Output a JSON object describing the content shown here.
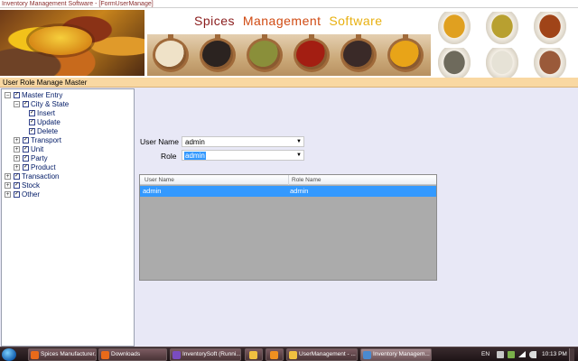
{
  "window": {
    "title": "Inventory Management Software - [FormUserManage]"
  },
  "banner": {
    "title_parts": [
      "Spices",
      "Management",
      "Software"
    ],
    "colors": {
      "spices": "#8a1c1c",
      "management": "#d04a12",
      "software": "#e8b010"
    },
    "spoon_colors": [
      "#efe2c8",
      "#2b2320",
      "#8a8f3a",
      "#a31e12",
      "#3a2a28",
      "#e8a418"
    ],
    "powder_colors": [
      "#e0a020",
      "#b8a030",
      "#a04418",
      "#6e6a5c",
      "#e6e2d6",
      "#9a5a3a"
    ]
  },
  "master": {
    "header": "User Role Manage Master"
  },
  "tree": {
    "nodes": [
      {
        "label": "Master Entry",
        "expander": "⊟",
        "checked": true
      },
      {
        "label": "City & State",
        "expander": "⊟",
        "checked": true
      },
      {
        "label": "Insert",
        "expander": "",
        "checked": true
      },
      {
        "label": "Update",
        "expander": "",
        "checked": true
      },
      {
        "label": "Delete",
        "expander": "",
        "checked": true
      },
      {
        "label": "Transport",
        "expander": "⊞",
        "checked": true
      },
      {
        "label": "Unit",
        "expander": "⊞",
        "checked": true
      },
      {
        "label": "Party",
        "expander": "⊞",
        "checked": true
      },
      {
        "label": "Product",
        "expander": "⊞",
        "checked": true
      },
      {
        "label": "Transaction",
        "expander": "⊞",
        "checked": true
      },
      {
        "label": "Stock",
        "expander": "⊞",
        "checked": true
      },
      {
        "label": "Other",
        "expander": "⊞",
        "checked": true
      }
    ]
  },
  "form": {
    "user_name_label": "User Name",
    "user_name_value": "admin",
    "role_label": "Role",
    "role_value": "admin",
    "dropdown_arrow": "▼"
  },
  "grid": {
    "columns": [
      "User Name",
      "Role Name"
    ],
    "rows": [
      [
        "admin",
        "admin"
      ]
    ],
    "selection_color": "#3399ff"
  },
  "taskbar": {
    "items": [
      {
        "label": "Spices Manufacturer...",
        "icon": "firefox-icon",
        "color": "#e86a1a"
      },
      {
        "label": "Downloads",
        "icon": "firefox-icon",
        "color": "#e86a1a"
      },
      {
        "label": "InventorySoft (Runni...",
        "icon": "visual-studio-icon",
        "color": "#7a4cc0"
      },
      {
        "label": "",
        "icon": "folder-icon",
        "color": "#f0c040"
      },
      {
        "label": "",
        "icon": "media-player-icon",
        "color": "#f09020"
      },
      {
        "label": "UserManagement - ...",
        "icon": "folder-icon",
        "color": "#f0c040"
      },
      {
        "label": "Inventory Managem...",
        "icon": "app-window-icon",
        "color": "#4a8ad0"
      }
    ],
    "tray": {
      "language": "EN",
      "clock": "10:13 PM"
    }
  }
}
